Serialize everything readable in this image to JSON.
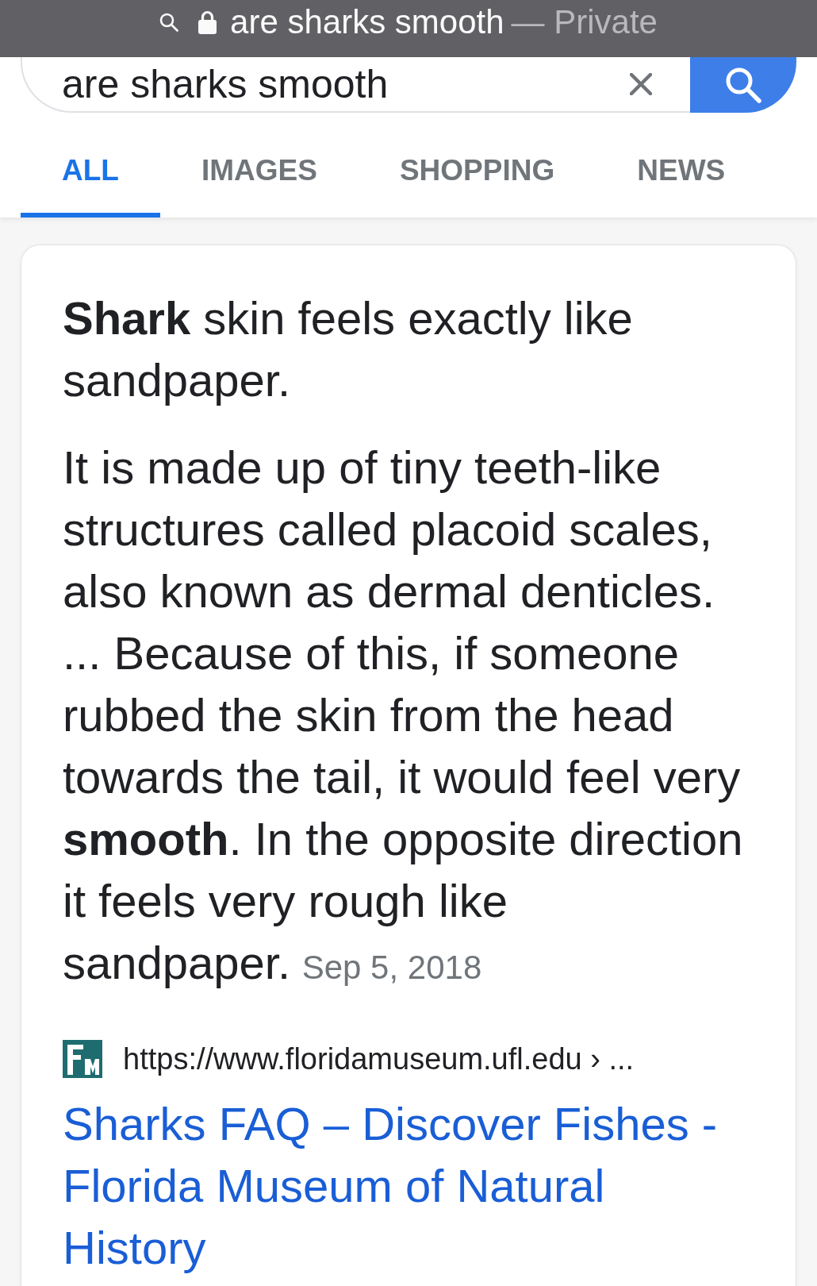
{
  "address_bar": {
    "query": "are sharks smooth",
    "mode": "— Private"
  },
  "search": {
    "value": "are sharks smooth"
  },
  "tabs": [
    {
      "label": "ALL",
      "selected": true
    },
    {
      "label": "IMAGES",
      "selected": false
    },
    {
      "label": "SHOPPING",
      "selected": false
    },
    {
      "label": "NEWS",
      "selected": false
    }
  ],
  "result": {
    "answer": "**Shark** skin feels exactly like sandpaper.",
    "snippet": "It is made up of tiny teeth-like structures called placoid scales, also known as dermal denticles. ... Because of this, if someone rubbed the skin from the head towards the tail, it would feel very **smooth**. In the opposite direction it feels very rough like sandpaper.",
    "date": "Sep 5, 2018",
    "url": "https://www.floridamuseum.ufl.edu › ...",
    "title": "Sharks FAQ – Discover Fishes - Florida Museum of Natural History"
  }
}
